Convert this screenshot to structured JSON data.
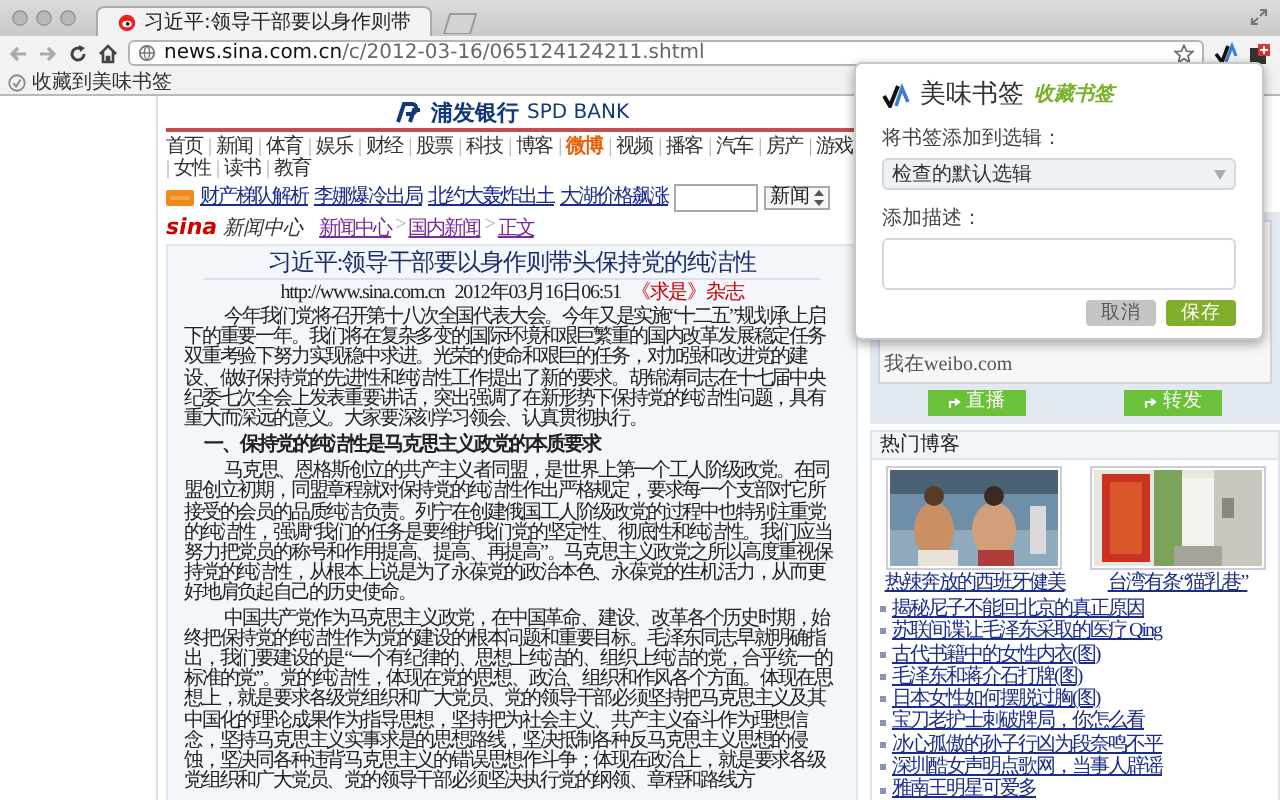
{
  "browser": {
    "tabs": [
      {
        "title": "习近平:领导干部要以身作则带",
        "selected": true
      }
    ],
    "address": {
      "host": "news.sina.com.cn",
      "path": "/c/2012-03-16/065124124211.shtml"
    },
    "bookmarks": [
      {
        "label": "收藏到美味书签"
      }
    ]
  },
  "page": {
    "banner": {
      "name": "浦发银行",
      "english": "SPD BANK"
    },
    "nav_separator": "|",
    "nav": [
      {
        "label": "首页",
        "highlighted": false
      },
      {
        "label": "新闻",
        "highlighted": false
      },
      {
        "label": "体育",
        "highlighted": false
      },
      {
        "label": "娱乐",
        "highlighted": false
      },
      {
        "label": "财经",
        "highlighted": false
      },
      {
        "label": "股票",
        "highlighted": false
      },
      {
        "label": "科技",
        "highlighted": false
      },
      {
        "label": "博客",
        "highlighted": false
      },
      {
        "label": "微博",
        "highlighted": true
      },
      {
        "label": "视频",
        "highlighted": false
      },
      {
        "label": "播客",
        "highlighted": false
      },
      {
        "label": "汽车",
        "highlighted": false
      },
      {
        "label": "房产",
        "highlighted": false
      },
      {
        "label": "游戏",
        "highlighted": false
      },
      {
        "label": "女性",
        "highlighted": false
      },
      {
        "label": "读书",
        "highlighted": false
      },
      {
        "label": "教育",
        "highlighted": false
      }
    ],
    "hot_links": [
      "财产梯队解析",
      "李娜爆冷出局",
      "北约大轰炸出土",
      "大湖价格飙涨"
    ],
    "search_select": "新闻",
    "logo": {
      "brand": "sina",
      "section": "新闻中心"
    },
    "breadcrumb_separator": ">",
    "breadcrumb": [
      "新闻中心",
      "国内新闻",
      "正文"
    ],
    "article": {
      "title": "习近平:领导干部要以身作则带头保持党的纯洁性",
      "url": "http://www.sina.com.cn",
      "date": "2012年03月16日06:51",
      "source": "《求是》杂志",
      "blocks": [
        {
          "kind": "para",
          "text": "今年我们党将召开第十八次全国代表大会。今年又是实施“十二五”规划承上启下的重要一年。我们将在复杂多变的国际环境和艰巨繁重的国内改革发展稳定任务双重考验下努力实现稳中求进。光荣的使命和艰巨的任务，对加强和改进党的建设、做好保持党的先进性和纯洁性工作提出了新的要求。胡锦涛同志在十七届中央纪委七次全会上发表重要讲话，突出强调了在新形势下保持党的纯洁性问题，具有重大而深远的意义。大家要深刻学习领会、认真贯彻执行。"
        },
        {
          "kind": "heading",
          "text": "一、保持党的纯洁性是马克思主义政党的本质要求"
        },
        {
          "kind": "para",
          "text": "马克思、恩格斯创立的共产主义者同盟，是世界上第一个工人阶级政党。在同盟创立初期，同盟章程就对保持党的纯洁性作出严格规定，要求每一个支部对它所接受的会员的品质纯洁负责。列宁在创建俄国工人阶级政党的过程中也特别注重党的纯洁性，强调“我们的任务是要维护我们党的坚定性、彻底性和纯洁性。我们应当努力把党员的称号和作用提高、提高、再提高”。马克思主义政党之所以高度重视保持党的纯洁性，从根本上说是为了永葆党的政治本色、永葆党的生机活力，从而更好地肩负起自己的历史使命。"
        },
        {
          "kind": "para",
          "text": "中国共产党作为马克思主义政党，在中国革命、建设、改革各个历史时期，始终把保持党的纯洁性作为党的建设的根本问题和重要目标。毛泽东同志早就明确指出，我们要建设的是“一个有纪律的、思想上纯洁的、组织上纯洁的党，合乎统一的标准的党”。党的纯洁性，体现在党的思想、政治、组织和作风各个方面。体现在思想上，就是要求各级党组织和广大党员、党的领导干部必须坚持把马克思主义及其中国化的理论成果作为指导思想，坚持把为社会主义、共产主义奋斗作为理想信念，坚持马克思主义实事求是的思想路线，坚决抵制各种反马克思主义思想的侵蚀，坚决同各种违背马克思主义的错误思想作斗争；体现在政治上，就是要求各级党组织和广大党员、党的领导干部必须坚决执行党的纲领、章程和路线方"
        }
      ]
    },
    "sidebar": {
      "weibo_text": "我在weibo.com",
      "weibo_buttons": [
        "直播",
        "转发"
      ],
      "hot_title": "热门博客",
      "photos": [
        {
          "kind": "picture",
          "caption": "热辣奔放的西班牙健美"
        },
        {
          "kind": "picture",
          "caption": "台湾有条“猫乳巷”"
        }
      ],
      "links": [
        "揭秘尼子不能回北京的真正原因",
        "苏联间谍让毛泽东采取的医疗 Qing",
        "古代书籍中的女性内衣(图)",
        "毛泽东和蒋介石打牌(图)",
        "日本女性如何摆脱过胸(图)",
        "宝刀老护士刺破牌局，你怎么看",
        "冰心孤傲的孙子行凶为段奈鸣不平",
        "深圳酷女声明点歌网，当事人辟谣",
        "雅南王明星可爱多"
      ]
    }
  },
  "popup": {
    "title": "美味书签",
    "subtitle": "收藏书签",
    "album_label": "将书签添加到选辑：",
    "album": "检查的默认选辑",
    "desc_label": "添加描述：",
    "buttons": [
      {
        "label": "取消",
        "disabled": true
      },
      {
        "label": "保存",
        "disabled": false
      }
    ]
  }
}
